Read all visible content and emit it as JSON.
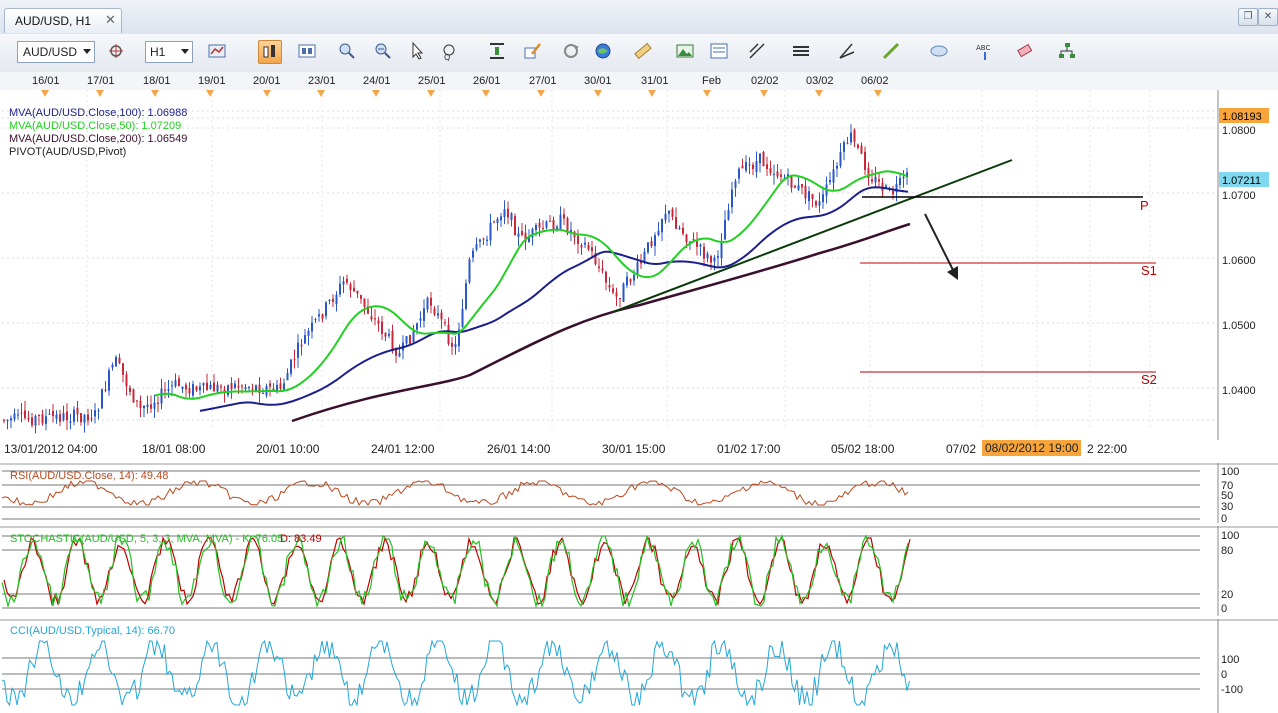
{
  "tab": {
    "title": "AUD/USD, H1",
    "close": "✕"
  },
  "toolbar": {
    "symbol": "AUD/USD",
    "timeframe": "H1"
  },
  "date_labels": [
    "16/01",
    "17/01",
    "18/01",
    "19/01",
    "20/01",
    "23/01",
    "24/01",
    "25/01",
    "26/01",
    "27/01",
    "30/01",
    "31/01",
    "Feb",
    "02/02",
    "03/02",
    "06/02"
  ],
  "time_labels": [
    "13/01/2012 04:00",
    "18/01 08:00",
    "20/01 10:00",
    "24/01 12:00",
    "26/01 14:00",
    "30/01 15:00",
    "01/02 17:00",
    "05/02 18:00",
    "07/02",
    "2 22:00"
  ],
  "time_highlight": "08/02/2012 19:00",
  "legend": {
    "mva100": "MVA(AUD/USD.Close,100): 1.06988",
    "mva50": "MVA(AUD/USD.Close,50): 1.07209",
    "mva200": "MVA(AUD/USD.Close,200): 1.06549",
    "pivot": "PIVOT(AUD/USD,Pivot)"
  },
  "price_axis": [
    "1.0800",
    "1.0700",
    "1.0600",
    "1.0500",
    "1.0400"
  ],
  "price_tags": {
    "top": "1.08193",
    "current": "1.07211"
  },
  "pivot_labels": {
    "p": "P",
    "s1": "S1",
    "s2": "S2"
  },
  "rsi": {
    "legend": "RSI(AUD/USD.Close, 14): 49.48",
    "axis": [
      "100",
      "70",
      "50",
      "30",
      "0"
    ]
  },
  "stoch": {
    "legend_a": "STOCHASTIC(AUD/USD, 5, 3, 3, MVA, MVA) -  K: 76.05",
    "legend_b": "D: 83.49",
    "axis": [
      "100",
      "80",
      "20",
      "0"
    ]
  },
  "cci": {
    "legend": "CCI(AUD/USD.Typical, 14): 66.70",
    "axis": [
      "100",
      "0",
      "-100"
    ]
  },
  "colors": {
    "mva100": "#1b1f8c",
    "mva50": "#22d022",
    "mva200": "#3a1030",
    "candle_up": "#2a57c8",
    "candle_down": "#c8283a",
    "pivot_s": "#c00000",
    "rsi": "#b84a20",
    "stoch_k": "#22c022",
    "stoch_d": "#c00000",
    "cci": "#22a8d8",
    "accent": "#f7a53a"
  },
  "icons": [
    "crosshair-icon",
    "bar-chart-icon",
    "candle-chart-icon",
    "zoom-in-icon",
    "zoom-out-icon",
    "cursor-icon",
    "zoom-box-icon",
    "indicator-icon",
    "draw-icon",
    "rotate-icon",
    "globe-icon",
    "ruler-icon",
    "image-icon",
    "template-icon",
    "fibonacci-icon",
    "lines-icon",
    "pencil-icon",
    "brush-icon",
    "ellipse-icon",
    "text-icon",
    "eraser-icon",
    "tree-icon"
  ]
}
